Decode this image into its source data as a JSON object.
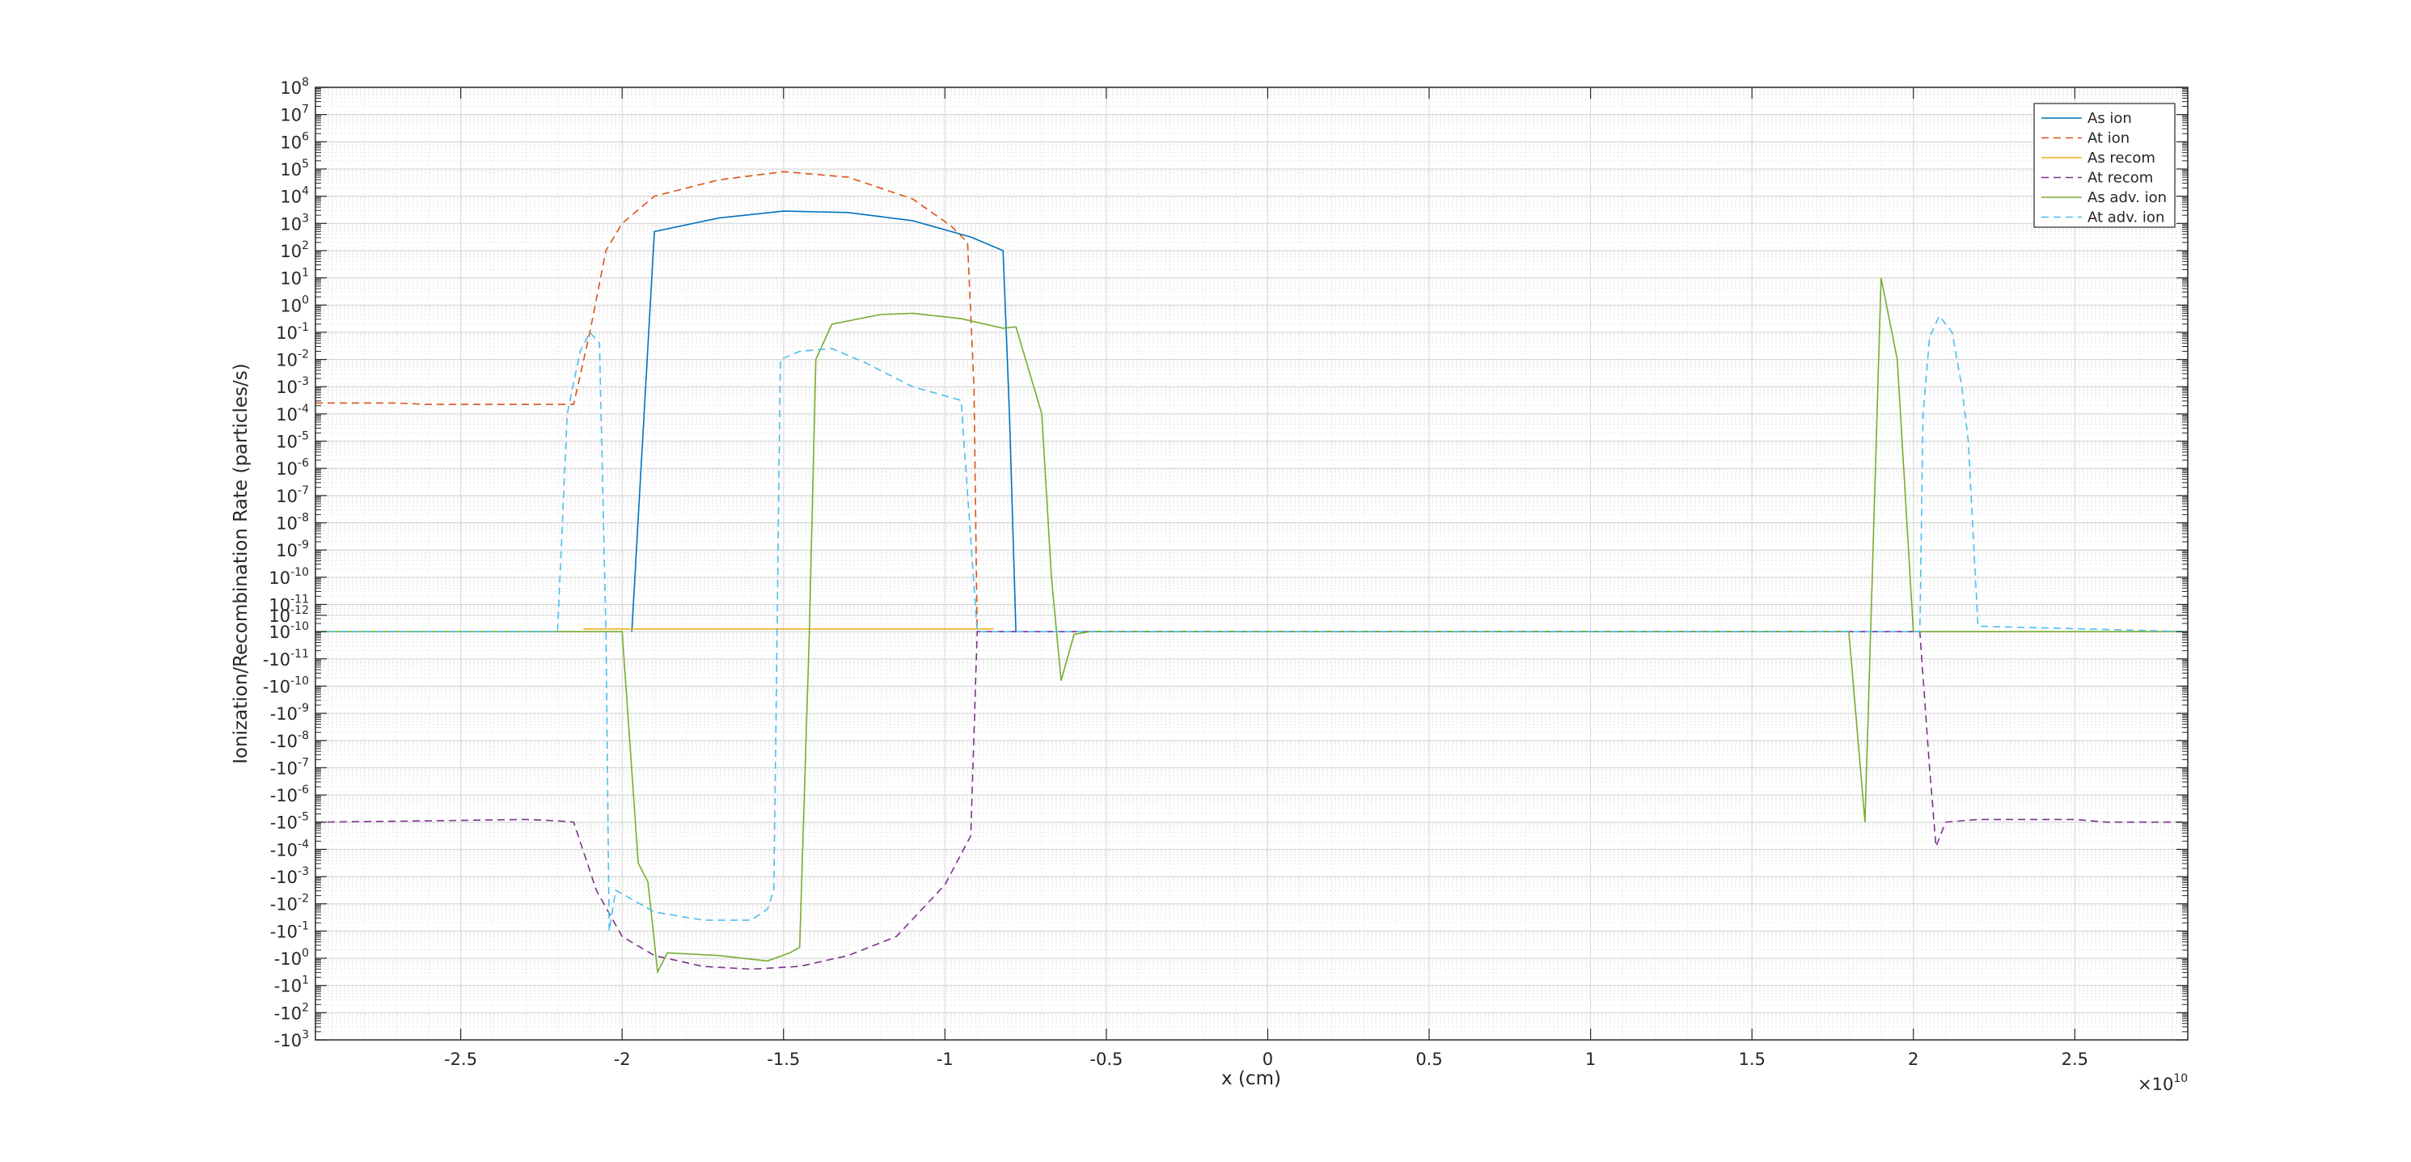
{
  "chart_data": {
    "type": "line",
    "xlabel": "x (cm)",
    "ylabel": "Ionization/Recombination Rate (particles/s)",
    "x_exponent_label": "×10",
    "x_exponent_power": "10",
    "xlim": [
      -2.95,
      2.85
    ],
    "x_tick_values": [
      -2.5,
      -2,
      -1.5,
      -1,
      -0.5,
      0,
      0.5,
      1,
      1.5,
      2,
      2.5
    ],
    "x_tick_labels": [
      "-2.5",
      "-2",
      "-1.5",
      "-1",
      "-0.5",
      "0",
      "0.5",
      "1",
      "1.5",
      "2",
      "2.5"
    ],
    "y_scale": "symlog",
    "y_ticks": [
      {
        "base": "10",
        "exp": "8",
        "v": 20
      },
      {
        "base": "10",
        "exp": "7",
        "v": 19
      },
      {
        "base": "10",
        "exp": "6",
        "v": 18
      },
      {
        "base": "10",
        "exp": "5",
        "v": 17
      },
      {
        "base": "10",
        "exp": "4",
        "v": 16
      },
      {
        "base": "10",
        "exp": "3",
        "v": 15
      },
      {
        "base": "10",
        "exp": "2",
        "v": 14
      },
      {
        "base": "10",
        "exp": "1",
        "v": 13
      },
      {
        "base": "10",
        "exp": "0",
        "v": 12
      },
      {
        "base": "10",
        "exp": "-1",
        "v": 11
      },
      {
        "base": "10",
        "exp": "-2",
        "v": 10
      },
      {
        "base": "10",
        "exp": "-3",
        "v": 9
      },
      {
        "base": "10",
        "exp": "-4",
        "v": 8
      },
      {
        "base": "10",
        "exp": "-5",
        "v": 7
      },
      {
        "base": "10",
        "exp": "-6",
        "v": 6
      },
      {
        "base": "10",
        "exp": "-7",
        "v": 5
      },
      {
        "base": "10",
        "exp": "-8",
        "v": 4
      },
      {
        "base": "10",
        "exp": "-9",
        "v": 3
      },
      {
        "base": "10",
        "exp": "-10",
        "v": 2
      },
      {
        "base": "10",
        "exp": "-11",
        "v": 1
      },
      {
        "base": "10",
        "exp": "-12",
        "v": 0.6
      },
      {
        "base": "10",
        "exp": "-10",
        "v": 0
      },
      {
        "base": "-10",
        "exp": "-11",
        "v": -1
      },
      {
        "base": "-10",
        "exp": "-10",
        "v": -2
      },
      {
        "base": "-10",
        "exp": "-9",
        "v": -3
      },
      {
        "base": "-10",
        "exp": "-8",
        "v": -4
      },
      {
        "base": "-10",
        "exp": "-7",
        "v": -5
      },
      {
        "base": "-10",
        "exp": "-6",
        "v": -6
      },
      {
        "base": "-10",
        "exp": "-5",
        "v": -7
      },
      {
        "base": "-10",
        "exp": "-4",
        "v": -8
      },
      {
        "base": "-10",
        "exp": "-3",
        "v": -9
      },
      {
        "base": "-10",
        "exp": "-2",
        "v": -10
      },
      {
        "base": "-10",
        "exp": "-1",
        "v": -11
      },
      {
        "base": "-10",
        "exp": "0",
        "v": -12
      },
      {
        "base": "-10",
        "exp": "1",
        "v": -13
      },
      {
        "base": "-10",
        "exp": "2",
        "v": -14
      },
      {
        "base": "-10",
        "exp": "3",
        "v": -15
      }
    ],
    "ylim_transformed": [
      -15,
      20
    ],
    "grid": true,
    "legend_position": "top-right",
    "series": [
      {
        "name": "As ion",
        "color": "#0072BD",
        "dash": "solid",
        "points": [
          [
            -1.97,
            0
          ],
          [
            -1.9,
            14.7
          ],
          [
            -1.7,
            15.2
          ],
          [
            -1.5,
            15.45
          ],
          [
            -1.3,
            15.4
          ],
          [
            -1.1,
            15.1
          ],
          [
            -0.92,
            14.5
          ],
          [
            -0.82,
            14.0
          ],
          [
            -0.8,
            8
          ],
          [
            -0.78,
            0
          ]
        ]
      },
      {
        "name": "At ion",
        "color": "#D95319",
        "dash": "dashed",
        "points": [
          [
            -2.95,
            8.4
          ],
          [
            -2.7,
            8.4
          ],
          [
            -2.6,
            8.35
          ],
          [
            -2.3,
            8.35
          ],
          [
            -2.15,
            8.35
          ],
          [
            -2.1,
            11
          ],
          [
            -2.05,
            14
          ],
          [
            -2.0,
            15
          ],
          [
            -1.9,
            16
          ],
          [
            -1.7,
            16.6
          ],
          [
            -1.5,
            16.9
          ],
          [
            -1.3,
            16.7
          ],
          [
            -1.1,
            15.9
          ],
          [
            -0.98,
            14.9
          ],
          [
            -0.93,
            14.3
          ],
          [
            -0.91,
            9
          ],
          [
            -0.9,
            0
          ]
        ]
      },
      {
        "name": "As recom",
        "color": "#EDB120",
        "dash": "solid",
        "points": [
          [
            -2.12,
            0.1
          ],
          [
            -0.85,
            0.1
          ]
        ]
      },
      {
        "name": "At recom",
        "color": "#7E2F8E",
        "dash": "dashed",
        "points": [
          [
            -2.95,
            -7.0
          ],
          [
            -2.6,
            -6.95
          ],
          [
            -2.3,
            -6.9
          ],
          [
            -2.2,
            -6.95
          ],
          [
            -2.15,
            -7.0
          ],
          [
            -2.08,
            -9.5
          ],
          [
            -2.0,
            -11.2
          ],
          [
            -1.9,
            -11.9
          ],
          [
            -1.75,
            -12.3
          ],
          [
            -1.6,
            -12.4
          ],
          [
            -1.45,
            -12.3
          ],
          [
            -1.3,
            -11.9
          ],
          [
            -1.15,
            -11.2
          ],
          [
            -1.0,
            -9.3
          ],
          [
            -0.92,
            -7.5
          ],
          [
            -0.9,
            0
          ],
          [
            1.9,
            0
          ],
          [
            2.02,
            0
          ],
          [
            2.05,
            -5
          ],
          [
            2.07,
            -7.9
          ],
          [
            2.1,
            -7.0
          ],
          [
            2.2,
            -6.9
          ],
          [
            2.5,
            -6.9
          ],
          [
            2.6,
            -7.0
          ],
          [
            2.85,
            -7.0
          ]
        ]
      },
      {
        "name": "As adv. ion",
        "color": "#77AC30",
        "dash": "solid",
        "points": [
          [
            -2.95,
            0
          ],
          [
            -2.0,
            0
          ],
          [
            -1.95,
            -8.5
          ],
          [
            -1.92,
            -9.2
          ],
          [
            -1.89,
            -12.5
          ],
          [
            -1.86,
            -11.8
          ],
          [
            -1.7,
            -11.9
          ],
          [
            -1.55,
            -12.1
          ],
          [
            -1.48,
            -11.8
          ],
          [
            -1.45,
            -11.6
          ],
          [
            -1.42,
            0
          ],
          [
            -1.4,
            10
          ],
          [
            -1.35,
            11.3
          ],
          [
            -1.2,
            11.65
          ],
          [
            -1.1,
            11.7
          ],
          [
            -0.95,
            11.5
          ],
          [
            -0.82,
            11.15
          ],
          [
            -0.78,
            11.2
          ],
          [
            -0.7,
            8
          ],
          [
            -0.67,
            2
          ],
          [
            -0.64,
            -1.8
          ],
          [
            -0.6,
            -0.1
          ],
          [
            -0.55,
            0
          ],
          [
            1.8,
            0
          ],
          [
            1.85,
            -7
          ],
          [
            1.9,
            13
          ],
          [
            1.95,
            10
          ],
          [
            2.0,
            0
          ],
          [
            2.85,
            0
          ]
        ]
      },
      {
        "name": "At adv. ion",
        "color": "#4DBEEE",
        "dash": "dashed",
        "points": [
          [
            -2.95,
            0
          ],
          [
            -2.2,
            0
          ],
          [
            -2.17,
            8
          ],
          [
            -2.13,
            10.3
          ],
          [
            -2.1,
            11
          ],
          [
            -2.07,
            10.6
          ],
          [
            -2.05,
            0
          ],
          [
            -2.04,
            -11
          ],
          [
            -2.02,
            -9.5
          ],
          [
            -1.9,
            -10.3
          ],
          [
            -1.75,
            -10.6
          ],
          [
            -1.6,
            -10.6
          ],
          [
            -1.55,
            -10.2
          ],
          [
            -1.53,
            -9.5
          ],
          [
            -1.52,
            0
          ],
          [
            -1.51,
            10
          ],
          [
            -1.45,
            10.3
          ],
          [
            -1.35,
            10.4
          ],
          [
            -1.25,
            9.9
          ],
          [
            -1.1,
            9.0
          ],
          [
            -0.95,
            8.5
          ],
          [
            -0.9,
            0
          ],
          [
            2.02,
            0
          ],
          [
            2.03,
            8
          ],
          [
            2.05,
            10.8
          ],
          [
            2.08,
            11.6
          ],
          [
            2.12,
            11
          ],
          [
            2.15,
            9
          ],
          [
            2.17,
            7
          ],
          [
            2.2,
            0.2
          ],
          [
            2.85,
            0
          ]
        ]
      }
    ]
  }
}
